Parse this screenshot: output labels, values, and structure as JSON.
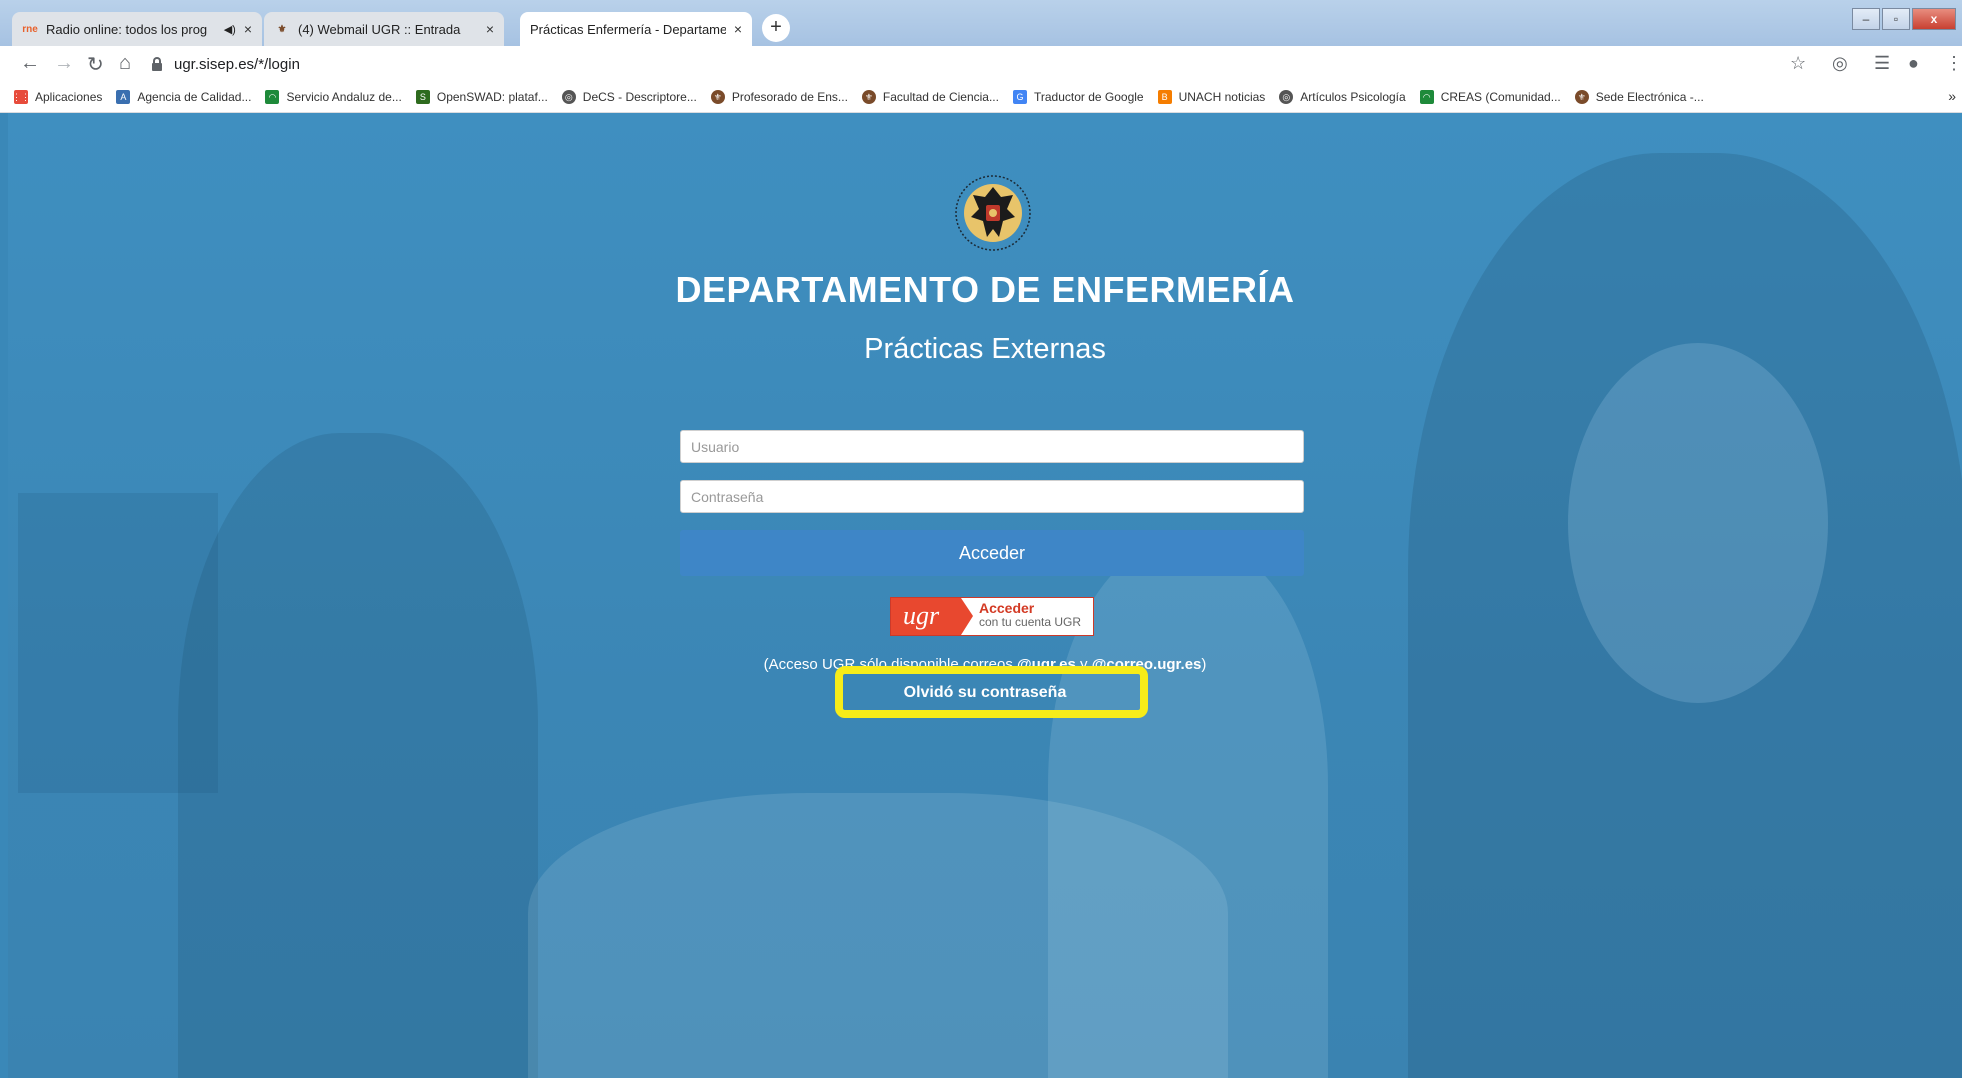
{
  "browser": {
    "tabs": [
      {
        "favicon": "rne",
        "title": "Radio online: todos los prog",
        "audio_icon": "speaker-icon",
        "active": false
      },
      {
        "favicon": "ugr-crest",
        "title": "(4) Webmail UGR :: Entrada",
        "active": false
      },
      {
        "favicon": "",
        "title": "Prácticas Enfermería - Departame",
        "active": true
      }
    ],
    "close_glyph": "×",
    "new_tab_glyph": "+",
    "url": "ugr.sisep.es/*/login",
    "bookmarks": [
      {
        "label": "Aplicaciones",
        "icon": "apps-grid-icon",
        "color": "#e74c3c"
      },
      {
        "label": "Agencia de Calidad...",
        "icon": "agency-icon",
        "color": "#3a6fb0"
      },
      {
        "label": "Servicio Andaluz de...",
        "icon": "junta-andalucia-icon",
        "color": "#1e8a3a"
      },
      {
        "label": "OpenSWAD: plataf...",
        "icon": "swad-icon",
        "color": "#2e6b1e"
      },
      {
        "label": "DeCS - Descriptore...",
        "icon": "globe-icon",
        "color": "#555555"
      },
      {
        "label": "Profesorado de Ens...",
        "icon": "ugr-crest-icon",
        "color": "#7a4b2a"
      },
      {
        "label": "Facultad de Ciencia...",
        "icon": "ugr-crest-icon",
        "color": "#7a4b2a"
      },
      {
        "label": "Traductor de Google",
        "icon": "google-translate-icon",
        "color": "#4285f4"
      },
      {
        "label": "UNACH noticias",
        "icon": "blogger-icon",
        "color": "#f57d00"
      },
      {
        "label": "Artículos Psicología",
        "icon": "globe-icon",
        "color": "#555555"
      },
      {
        "label": "CREAS (Comunidad...",
        "icon": "junta-andalucia-icon",
        "color": "#1e8a3a"
      },
      {
        "label": "Sede Electrónica -...",
        "icon": "ugr-crest-icon",
        "color": "#7a4b2a"
      }
    ],
    "more_glyph": "»"
  },
  "login": {
    "title": "DEPARTAMENTO DE ENFERMERÍA",
    "subtitle": "Prácticas Externas",
    "username_placeholder": "Usuario",
    "password_placeholder": "Contraseña",
    "submit_label": "Acceder",
    "ugr_logo_text": "ugr",
    "ugr_button_line1": "Acceder",
    "ugr_button_line2": "con tu cuenta UGR",
    "note_prefix": "(Acceso UGR sólo disponible correos ",
    "note_domain1": "@ugr.es",
    "note_mid": " y ",
    "note_domain2": "@correo.ugr.es",
    "note_suffix": ")",
    "forgot_label": "Olvidó su contraseña"
  },
  "colors": {
    "accent": "#3e86c7",
    "background": "#3a88b8",
    "highlight": "#f7ec19",
    "ugr_red": "#e8482f"
  }
}
